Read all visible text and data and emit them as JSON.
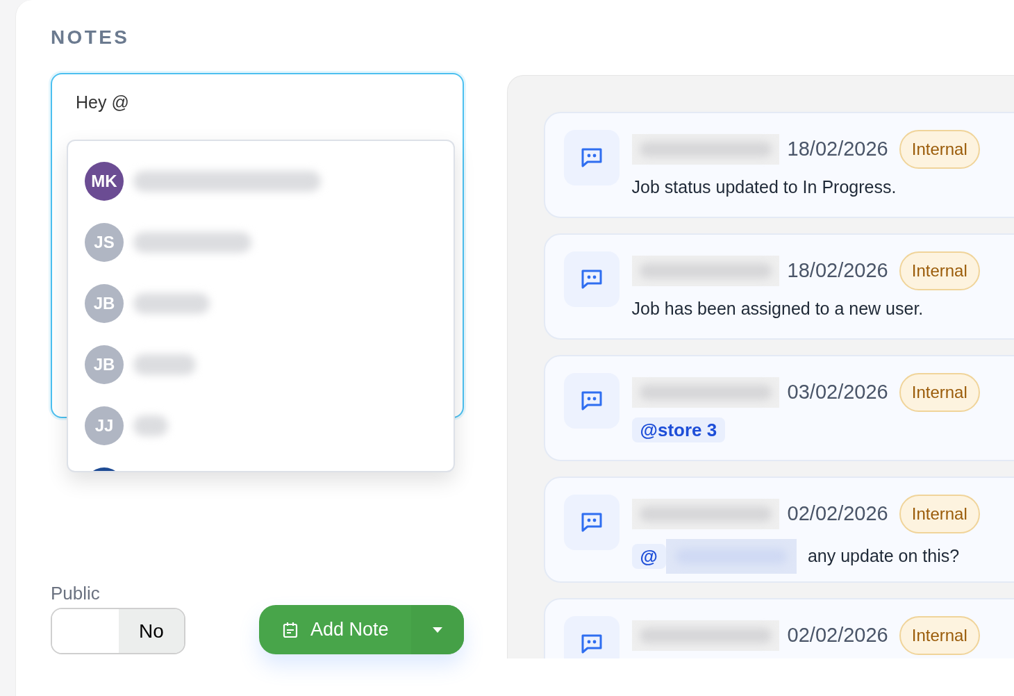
{
  "section_title": "NOTES",
  "composer": {
    "value": "Hey @",
    "mention_menu": {
      "items": [
        {
          "initials": "MK",
          "color": "#6b4c93"
        },
        {
          "initials": "JS",
          "color": "#b0b6c3"
        },
        {
          "initials": "JB",
          "color": "#b0b6c3"
        },
        {
          "initials": "JB",
          "color": "#b0b6c3"
        },
        {
          "initials": "JJ",
          "color": "#b0b6c3"
        },
        {
          "color": "#1d4a93"
        }
      ]
    }
  },
  "public_toggle": {
    "label": "Public",
    "value": "No",
    "on": false
  },
  "add_button": {
    "label": "Add Note"
  },
  "notes": [
    {
      "date": "18/02/2026",
      "badge": "Internal",
      "body": [
        {
          "kind": "text",
          "text": "Job status updated to In Progress."
        }
      ]
    },
    {
      "date": "18/02/2026",
      "badge": "Internal",
      "body": [
        {
          "kind": "text",
          "text": "Job has been assigned to a new user."
        }
      ]
    },
    {
      "date": "03/02/2026",
      "badge": "Internal",
      "body": [
        {
          "kind": "mention",
          "text": "@store 3",
          "redacted": false
        }
      ]
    },
    {
      "date": "02/02/2026",
      "badge": "Internal",
      "body": [
        {
          "kind": "mention",
          "text": "@",
          "redacted": true
        },
        {
          "kind": "text",
          "text": "any update on this?"
        }
      ]
    },
    {
      "date": "02/02/2026",
      "badge": "Internal"
    }
  ]
}
